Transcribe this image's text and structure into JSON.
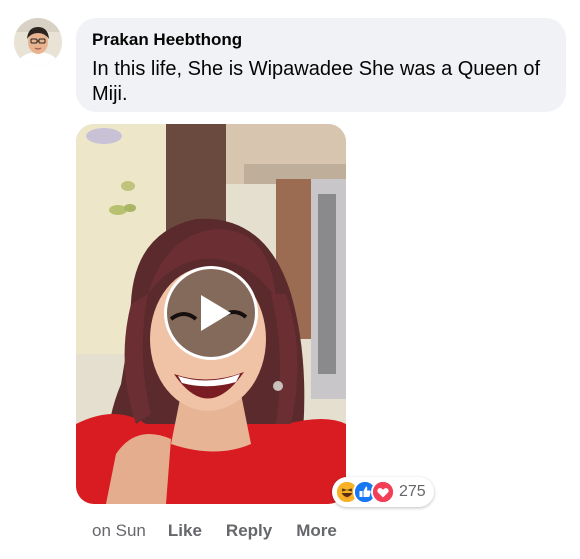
{
  "comment": {
    "author": "Prakan Heebthong",
    "text": "In this life, She is Wipawadee She was a Queen of Miji.",
    "avatar_icon": "user-avatar",
    "video": {
      "play_icon": "play-icon"
    },
    "reactions": {
      "icons": [
        "haha-icon",
        "like-icon",
        "love-icon"
      ],
      "count": "275"
    },
    "timestamp": "on Sun",
    "actions": {
      "like": "Like",
      "reply": "Reply",
      "more": "More"
    }
  },
  "colors": {
    "bubble_bg": "#f0f2f5",
    "secondary_text": "#65676b",
    "like_blue": "#1877f2",
    "love_red": "#f33e58",
    "haha_yellow": "#f7b125"
  }
}
